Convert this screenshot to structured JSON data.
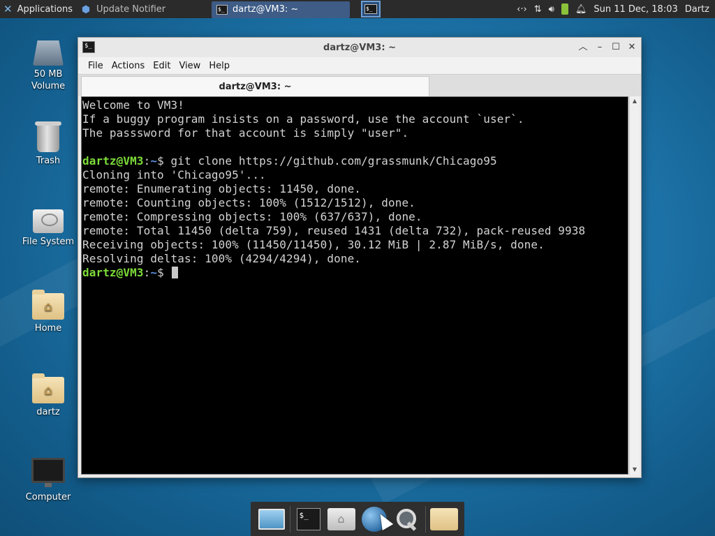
{
  "top_panel": {
    "applications_label": "Applications",
    "tasks": [
      {
        "label": "Update Notifier",
        "active": false
      },
      {
        "label": "dartz@VM3: ~",
        "active": true
      }
    ],
    "clock": "Sun 11 Dec, 18:03",
    "user": "Dartz"
  },
  "desktop_icons": [
    {
      "label": "50 MB\nVolume",
      "icon": "drive-icon"
    },
    {
      "label": "Trash",
      "icon": "trash-icon"
    },
    {
      "label": "File System",
      "icon": "hard-disk-icon"
    },
    {
      "label": "Home",
      "icon": "home-folder-icon"
    },
    {
      "label": "dartz",
      "icon": "home-folder-icon"
    },
    {
      "label": "Computer",
      "icon": "monitor-icon"
    }
  ],
  "terminal": {
    "title": "dartz@VM3: ~",
    "menu": [
      "File",
      "Actions",
      "Edit",
      "View",
      "Help"
    ],
    "tab_label": "dartz@VM3: ~",
    "prompt_user": "dartz@VM3",
    "prompt_path": "~",
    "prompt_symbol": "$",
    "lines": {
      "welcome": "Welcome to VM3!",
      "note1": "If a buggy program insists on a password, use the account `user`.",
      "note2": "The passsword for that account is simply \"user\".",
      "command": " git clone https://github.com/grassmunk/Chicago95",
      "out1": "Cloning into 'Chicago95'...",
      "out2": "remote: Enumerating objects: 11450, done.",
      "out3": "remote: Counting objects: 100% (1512/1512), done.",
      "out4": "remote: Compressing objects: 100% (637/637), done.",
      "out5": "remote: Total 11450 (delta 759), reused 1431 (delta 732), pack-reused 9938",
      "out6": "Receiving objects: 100% (11450/11450), 30.12 MiB | 2.87 MiB/s, done.",
      "out7": "Resolving deltas: 100% (4294/4294), done."
    }
  },
  "dock": {
    "items": [
      "desktop-icon",
      "terminal-icon",
      "home-folder-icon",
      "web-browser-icon",
      "search-icon",
      "folder-icon"
    ]
  }
}
